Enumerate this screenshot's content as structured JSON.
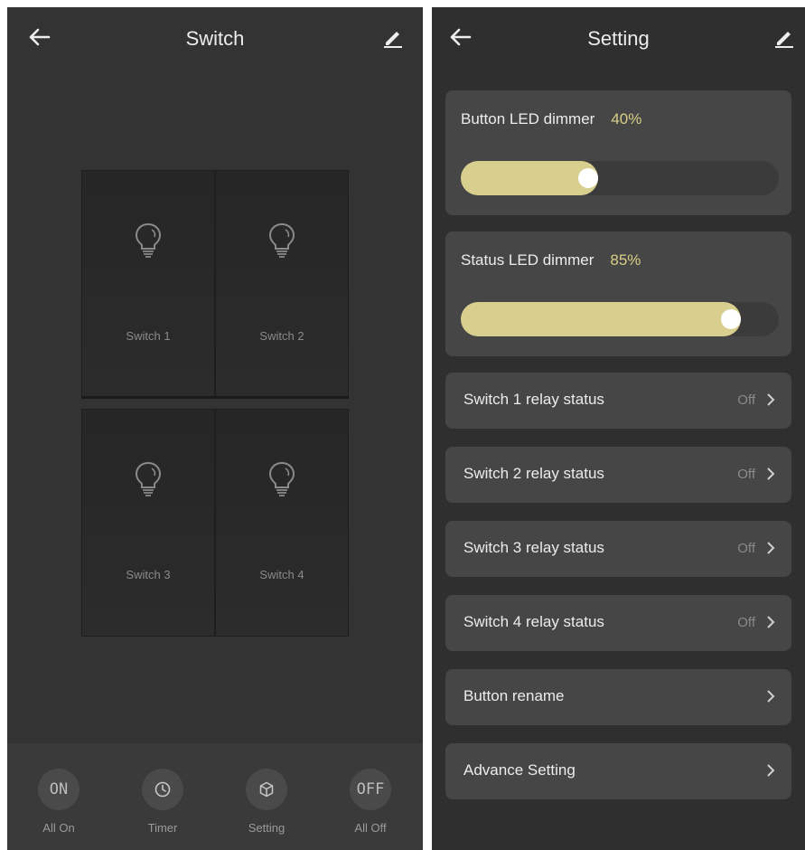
{
  "left": {
    "title": "Switch",
    "switches": [
      {
        "label": "Switch 1"
      },
      {
        "label": "Switch 2"
      },
      {
        "label": "Switch 3"
      },
      {
        "label": "Switch 4"
      }
    ],
    "toolbar": {
      "all_on": {
        "icon_text": "ON",
        "label": "All On"
      },
      "timer": {
        "icon": "clock-icon",
        "label": "Timer"
      },
      "setting": {
        "icon": "cube-icon",
        "label": "Setting"
      },
      "all_off": {
        "icon_text": "OFF",
        "label": "All Off"
      }
    }
  },
  "right": {
    "title": "Setting",
    "button_led": {
      "label": "Button LED dimmer",
      "value_text": "40%",
      "value": 0.4
    },
    "status_led": {
      "label": "Status LED dimmer",
      "value_text": "85%",
      "value": 0.85
    },
    "rows": [
      {
        "label": "Switch 1 relay status",
        "value": "Off"
      },
      {
        "label": "Switch 2 relay status",
        "value": "Off"
      },
      {
        "label": "Switch 3 relay status",
        "value": "Off"
      },
      {
        "label": "Switch 4 relay status",
        "value": "Off"
      },
      {
        "label": "Button rename",
        "value": ""
      },
      {
        "label": "Advance Setting",
        "value": ""
      }
    ]
  },
  "colors": {
    "accent": "#d8cf8e",
    "panel_bg": "#333333",
    "card_bg": "#464646"
  }
}
